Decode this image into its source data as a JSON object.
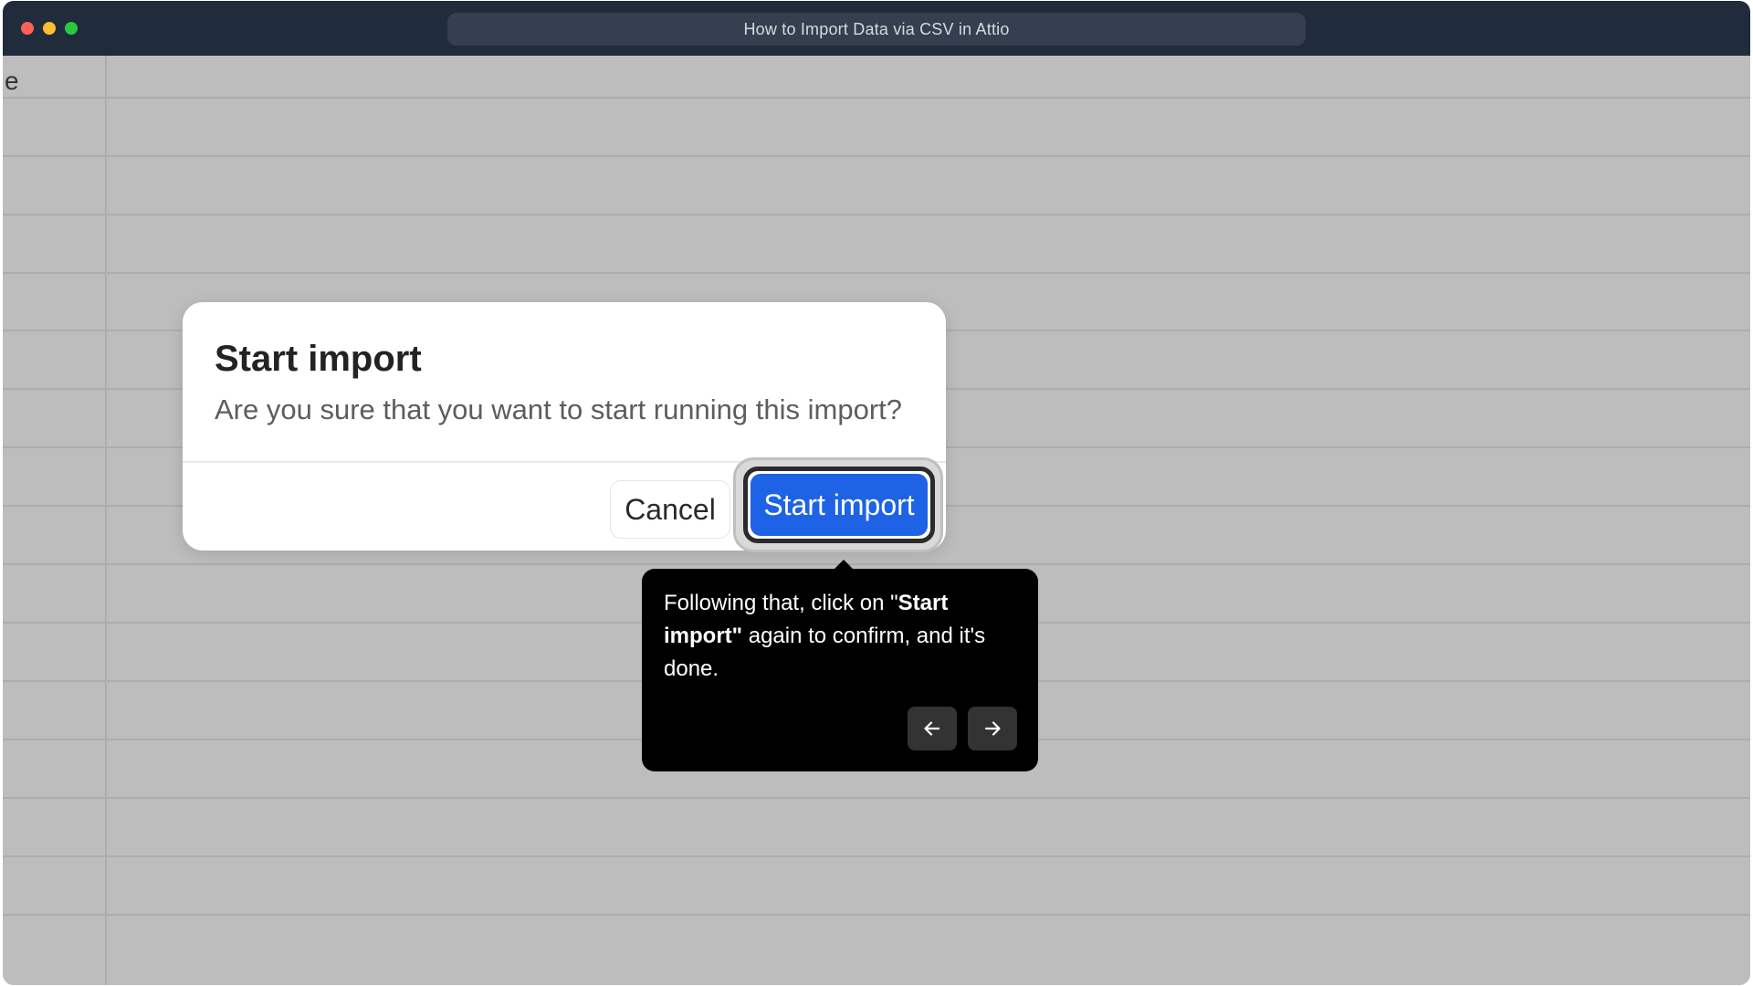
{
  "window": {
    "title": "How to Import Data via CSV in Attio",
    "partial_text": "e"
  },
  "dialog": {
    "title": "Start import",
    "message": "Are you sure that you want to start running this import?",
    "cancel_label": "Cancel",
    "confirm_label": "Start import"
  },
  "tooltip": {
    "text_before": "Following that, click on \"",
    "text_bold": "Start import\"",
    "text_after": " again to confirm, and it's done.",
    "prev_icon": "arrow-left-icon",
    "next_icon": "arrow-right-icon"
  },
  "colors": {
    "titlebar": "#202b3b",
    "primary_button": "#1e63e6",
    "tooltip_bg": "#000000",
    "backdrop": "#bdbdbd"
  }
}
